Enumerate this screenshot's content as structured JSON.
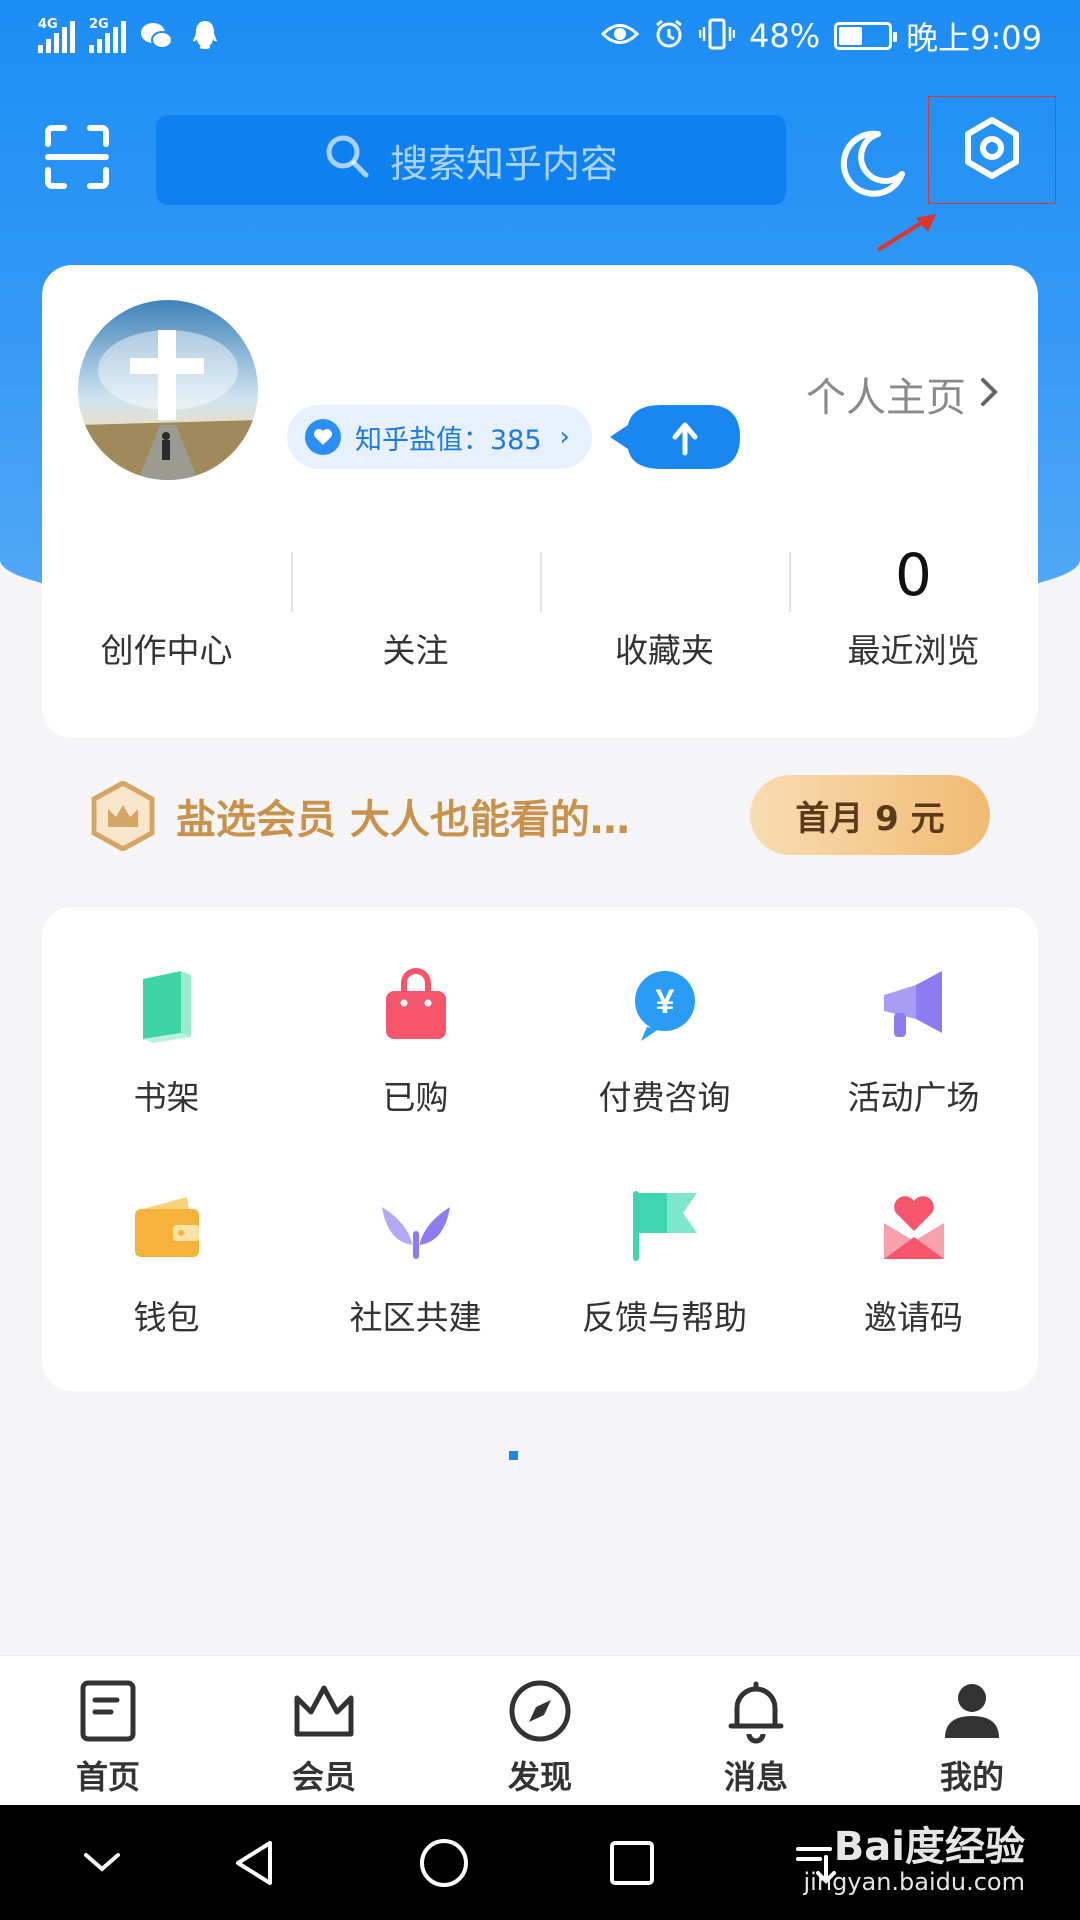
{
  "status_bar": {
    "network_1": "4G",
    "network_2": "2G",
    "battery": "48%",
    "battery_level": 0.48,
    "time": "晚上9:09"
  },
  "header": {
    "search_placeholder": "搜索知乎内容"
  },
  "profile": {
    "salt_label": "知乎盐值：385",
    "homepage_link": "个人主页",
    "stats": [
      {
        "value": "",
        "label": "创作中心"
      },
      {
        "value": "",
        "label": "关注"
      },
      {
        "value": "",
        "label": "收藏夹"
      },
      {
        "value": "0",
        "label": "最近浏览"
      }
    ]
  },
  "vip": {
    "promo_text": "盐选会员 大人也能看的…",
    "button_label": "首月 9 元"
  },
  "tools": [
    {
      "label": "书架",
      "icon": "bookshelf-icon",
      "color": "#3dd5a6"
    },
    {
      "label": "已购",
      "icon": "shopping-bag-icon",
      "color": "#f5566b"
    },
    {
      "label": "付费咨询",
      "icon": "paid-consult-icon",
      "color": "#2a9cf5"
    },
    {
      "label": "活动广场",
      "icon": "megaphone-icon",
      "color": "#8c7cf0"
    },
    {
      "label": "钱包",
      "icon": "wallet-icon",
      "color": "#f7b23b"
    },
    {
      "label": "社区共建",
      "icon": "sprout-icon",
      "color": "#9b8af5"
    },
    {
      "label": "反馈与帮助",
      "icon": "flag-icon",
      "color": "#3ed6b0"
    },
    {
      "label": "邀请码",
      "icon": "invite-heart-icon",
      "color": "#f5566b"
    }
  ],
  "bottom_nav": [
    {
      "label": "首页",
      "icon": "home-doc-icon"
    },
    {
      "label": "会员",
      "icon": "crown-icon"
    },
    {
      "label": "发现",
      "icon": "compass-icon"
    },
    {
      "label": "消息",
      "icon": "bell-icon"
    },
    {
      "label": "我的",
      "icon": "person-icon"
    }
  ],
  "watermark": {
    "brand": "Bai度经验",
    "url": "jingyan.baidu.com"
  },
  "colors": {
    "brand_blue": "#1c8df5",
    "vip_gold": "#c9924a",
    "highlight_red": "#e0342b"
  }
}
